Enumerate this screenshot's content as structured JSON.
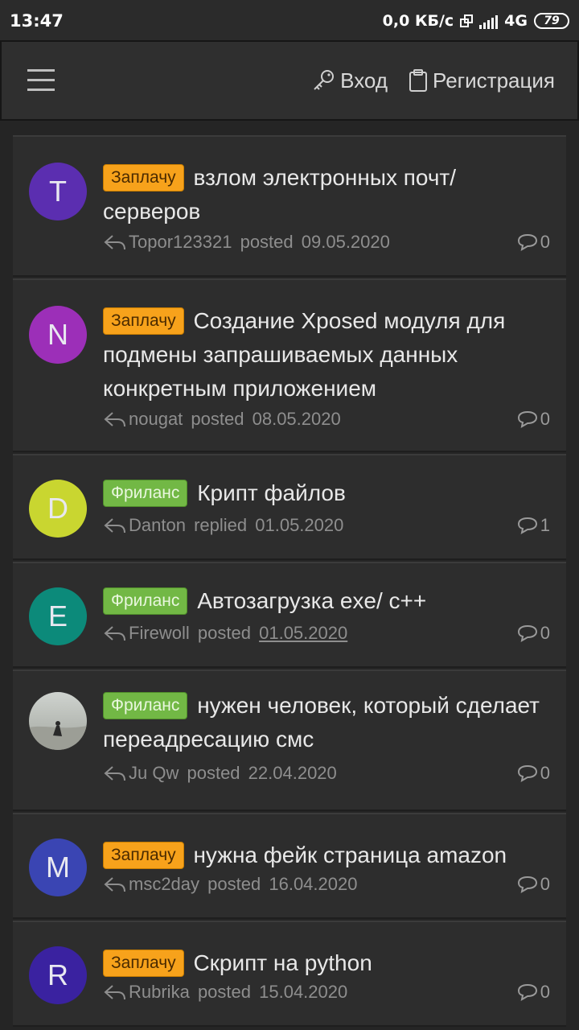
{
  "status_bar": {
    "time": "13:47",
    "speed": "0,0 КБ/с",
    "network": "4G",
    "battery": "79"
  },
  "header": {
    "login_label": "Вход",
    "register_label": "Регистрация"
  },
  "threads": [
    {
      "avatar_letter": "T",
      "avatar_color": "#5b2eb0",
      "badge": "Заплачу",
      "badge_type": "zap",
      "title": "взлом электронных почт/ серверов",
      "author": "Topor123321",
      "action": "posted",
      "date": "09.05.2020",
      "replies": "0"
    },
    {
      "avatar_letter": "N",
      "avatar_color": "#9c2fb8",
      "badge": "Заплачу",
      "badge_type": "zap",
      "title": "Создание Xposed модуля для подмены запрашиваемых данных конкретным приложением",
      "author": "nougat",
      "action": "posted",
      "date": "08.05.2020",
      "replies": "0"
    },
    {
      "avatar_letter": "D",
      "avatar_color": "#c9d630",
      "badge": "Фриланс",
      "badge_type": "fri",
      "title": "Крипт файлов",
      "author": "Danton",
      "action": "replied",
      "date": "01.05.2020",
      "replies": "1"
    },
    {
      "avatar_letter": "E",
      "avatar_color": "#0c8a7a",
      "badge": "Фриланс",
      "badge_type": "fri",
      "title": "Автозагрузка exe/ c++",
      "author": "Firewoll",
      "action": "posted",
      "date": "01.05.2020",
      "replies": "0"
    },
    {
      "avatar_letter": "",
      "avatar_color": "#b9bdb8",
      "badge": "Фриланс",
      "badge_type": "fri",
      "title": "нужен человек, который сделает переадресацию смс",
      "author": "Ju Qw",
      "action": "posted",
      "date": "22.04.2020",
      "replies": "0"
    },
    {
      "avatar_letter": "M",
      "avatar_color": "#3a45b3",
      "badge": "Заплачу",
      "badge_type": "zap",
      "title": "нужна фейк страница amazon",
      "author": "msc2day",
      "action": "posted",
      "date": "16.04.2020",
      "replies": "0"
    },
    {
      "avatar_letter": "R",
      "avatar_color": "#3a22a0",
      "badge": "Заплачу",
      "badge_type": "zap",
      "title": "Скрипт на python",
      "author": "Rubrika",
      "action": "posted",
      "date": "15.04.2020",
      "replies": "0"
    }
  ]
}
